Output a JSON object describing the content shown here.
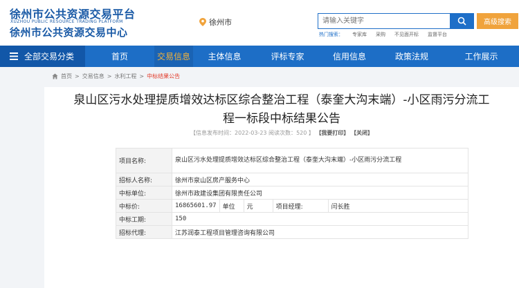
{
  "header": {
    "logo_cn1": "徐州市公共资源交易平台",
    "logo_en": "XUZHOU PUBLIC RESOURCE TRADING PLATFORM",
    "logo_cn2": "徐州市公共资源交易中心",
    "location": "徐州市",
    "search": {
      "placeholder": "请输入关键字",
      "search_icon": "search-icon"
    },
    "advanced_search": "高级搜索",
    "hot_label": "热门搜索：",
    "hot_items": [
      "专家库",
      "采购",
      "不见面开标",
      "监督平台"
    ]
  },
  "nav": {
    "all": "全部交易分类",
    "items": [
      "首页",
      "交易信息",
      "主体信息",
      "评标专家",
      "信用信息",
      "政策法规",
      "工作展示"
    ],
    "active_index": 1,
    "active_color": "#f3b23a",
    "bg_color": "#1d6ec6"
  },
  "breadcrumb": [
    "首页",
    "交易信息",
    "水利工程",
    "中标结果公告"
  ],
  "article": {
    "title_line1": "泉山区污水处理提质增效达标区综合整治工程（泰奎大沟末端）-小区雨污分流工",
    "title_line2": "程一标段中标结果公告",
    "meta_publish_label": "【信息发布时间：",
    "meta_publish_date": "2022-03-23",
    "meta_views_label": " 阅读次数：",
    "meta_views": "520",
    "meta_close": " 】",
    "print": "【我要打印】",
    "close": "【关闭】"
  },
  "table": {
    "project_name_label": "项目名称:",
    "project_name": "泉山区污水处理提质增效达标区综合整治工程（泰奎大沟末端）-小区雨污分流工程",
    "tenderer_label": "招标人名称:",
    "tenderer": "徐州市泉山区房产服务中心",
    "winner_label": "中标单位:",
    "winner": "徐州市政建设集团有限责任公司",
    "price_label": "中标价:",
    "price": "16865601.97",
    "unit_label": "单位",
    "unit": "元",
    "manager_label": "项目经理:",
    "manager": "闫长胜",
    "period_label": "中标工期:",
    "period": "150",
    "agent_label": "招标代理:",
    "agent": "江苏润泰工程项目管理咨询有限公司"
  }
}
